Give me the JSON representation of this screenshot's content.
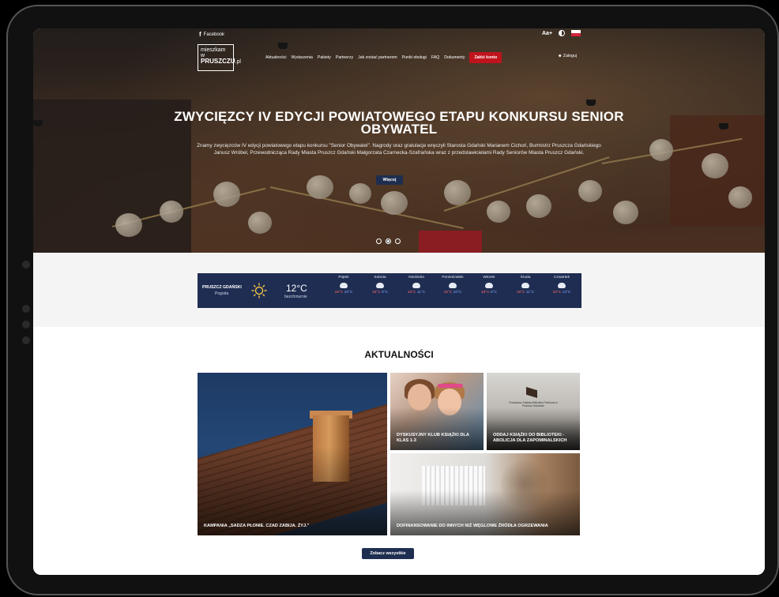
{
  "topbar": {
    "facebook_label": "Facebook",
    "font_size_label": "Aa+"
  },
  "logo": {
    "line1": "mieszkam",
    "line2": "w",
    "line3": "PRUSZCZU",
    "suffix": ".pl"
  },
  "nav": {
    "items": [
      {
        "label": "Aktualności"
      },
      {
        "label": "Wydarzenia"
      },
      {
        "label": "Pakiety"
      },
      {
        "label": "Partnerzy"
      },
      {
        "label": "Jak zostać partnerem"
      },
      {
        "label": "Punkt obsługi"
      },
      {
        "label": "FAQ"
      },
      {
        "label": "Dokumenty"
      }
    ],
    "cta_label": "Załóż konto",
    "login_label": "Zaloguj"
  },
  "hero": {
    "title": "ZWYCIĘZCY IV EDYCJI POWIATOWEGO ETAPU KONKURSU SENIOR OBYWATEL",
    "description": "Znamy zwycięzców IV edycji powiatowego etapu konkursu \"Senior Obywatel\". Nagrody oraz gratulacje wręczyli Starosta Gdański Marianem Cichoń, Burmistrz Pruszcza Gdańskiego Janusz Wróbel, Przewodnicząca Rady Miasta Pruszcz Gdański Małgorzata Czarnecka-Szafrańska wraz z przedstawicielami Rady Seniorów Miasta Pruszcz Gdański.",
    "button_label": "Więcej",
    "slides": 3,
    "active_slide": 2
  },
  "weather": {
    "city": "PRUSZCZ GDAŃSKI",
    "label": "Pogoda",
    "current_temp": "12°C",
    "condition": "bezchmurnie",
    "days": [
      {
        "name": "Piątek",
        "hi": "15°C",
        "lo": "10°C"
      },
      {
        "name": "Sobota",
        "hi": "16°C",
        "lo": "9°C"
      },
      {
        "name": "Niedziela",
        "hi": "15°C",
        "lo": "11°C"
      },
      {
        "name": "Poniedziałek",
        "hi": "15°C",
        "lo": "10°C"
      },
      {
        "name": "Wtorek",
        "hi": "16°C",
        "lo": "9°C"
      },
      {
        "name": "Środa",
        "hi": "18°C",
        "lo": "11°C"
      },
      {
        "name": "Czwartek",
        "hi": "23°C",
        "lo": "13°C"
      }
    ]
  },
  "news": {
    "title": "AKTUALNOŚCI",
    "articles": [
      {
        "title": "KAMPANIA „SADZA PŁONIE. CZAD ZABIJA. ŻYJ.\""
      },
      {
        "title": "DYSKUSYJNY KLUB KSIĄŻKI DLA KLAS 1-3"
      },
      {
        "title": "ODDAJ KSIĄŻKI DO BIBLIOTEKI - ABOLICJA DLA ZAPOMINALSKICH"
      },
      {
        "title": "DOFINANSOWANIE DO INNYCH NIŻ WĘGLOWE ŹRÓDŁA OGRZEWANIA"
      }
    ],
    "library_sign": "Powiatowa i Miejska Biblioteka Publiczna w Pruszczu Gdańskim",
    "see_all_label": "Zobacz wszystkie"
  },
  "colors": {
    "navy": "#1e2e50",
    "cta_red": "#c0141d",
    "temp_high": "#ff6b6b",
    "temp_low": "#7fa8ff"
  }
}
